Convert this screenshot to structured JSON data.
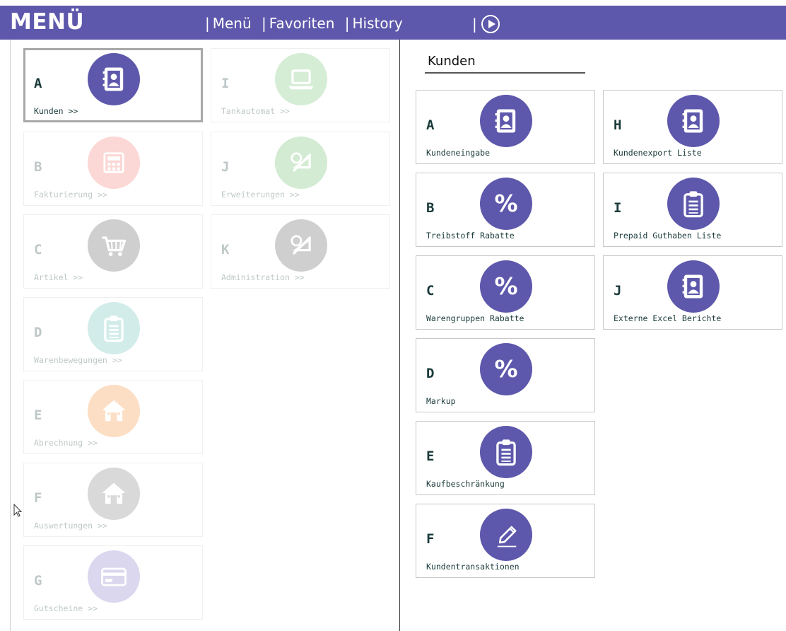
{
  "header": {
    "title": "MENÜ",
    "nav": [
      {
        "sep": "|",
        "label": "Menü"
      },
      {
        "sep": "|",
        "label": "Favoriten"
      },
      {
        "sep": "|",
        "label": "History"
      }
    ],
    "play_sep": "|",
    "play_icon": "play-circle-icon"
  },
  "left_tiles": [
    {
      "letter": "A",
      "label": "Kunden >>",
      "icon": "contacts-book-icon",
      "color": "#5d58ab",
      "state": "selected"
    },
    {
      "letter": "B",
      "label": "Fakturierung >>",
      "icon": "calculator-icon",
      "color": "#f2726a",
      "state": "faded"
    },
    {
      "letter": "C",
      "label": "Artikel >>",
      "icon": "shopping-cart-icon",
      "color": "#555555",
      "state": "faded"
    },
    {
      "letter": "D",
      "label": "Warenbewegungen >>",
      "icon": "clipboard-icon",
      "color": "#5fbdb5",
      "state": "faded"
    },
    {
      "letter": "E",
      "label": "Abrechnung >>",
      "icon": "home-icon",
      "color": "#f68a30",
      "state": "faded"
    },
    {
      "letter": "F",
      "label": "Auswertungen >>",
      "icon": "home-icon",
      "color": "#7a7a7a",
      "state": "faded"
    },
    {
      "letter": "G",
      "label": "Gutscheine >>",
      "icon": "card-icon",
      "color": "#7f72c4",
      "state": "faded"
    },
    {
      "letter": "I",
      "label": "Tankautomat >>",
      "icon": "laptop-icon",
      "color": "#6cc06c",
      "state": "faded"
    },
    {
      "letter": "J",
      "label": "Erweiterungen >>",
      "icon": "ruler-tools-icon",
      "color": "#5fb85f",
      "state": "faded"
    },
    {
      "letter": "K",
      "label": "Administration >>",
      "icon": "ruler-tools-icon",
      "color": "#555555",
      "state": "faded"
    }
  ],
  "section": {
    "title": "Kunden"
  },
  "right_tiles": [
    {
      "letter": "A",
      "label": "Kundeneingabe",
      "icon": "contacts-book-icon",
      "color": "#5d58ab"
    },
    {
      "letter": "B",
      "label": "Treibstoff Rabatte",
      "icon": "percent-icon",
      "color": "#5d58ab"
    },
    {
      "letter": "C",
      "label": "Warengruppen Rabatte",
      "icon": "percent-icon",
      "color": "#5d58ab"
    },
    {
      "letter": "D",
      "label": "Markup",
      "icon": "percent-icon",
      "color": "#5d58ab"
    },
    {
      "letter": "E",
      "label": "Kaufbeschränkung",
      "icon": "clipboard-icon",
      "color": "#5d58ab"
    },
    {
      "letter": "F",
      "label": "Kundentransaktionen",
      "icon": "pencil-icon",
      "color": "#5d58ab"
    },
    {
      "letter": "H",
      "label": "Kundenexport Liste",
      "icon": "contacts-book-icon",
      "color": "#5d58ab"
    },
    {
      "letter": "I",
      "label": "Prepaid Guthaben Liste",
      "icon": "clipboard-icon",
      "color": "#5d58ab"
    },
    {
      "letter": "J",
      "label": "Externe Excel Berichte",
      "icon": "contacts-book-icon",
      "color": "#5d58ab"
    }
  ],
  "colors": {
    "header_bg": "#5d58ab",
    "accent": "#5d58ab",
    "text": "#1a3a3a"
  }
}
